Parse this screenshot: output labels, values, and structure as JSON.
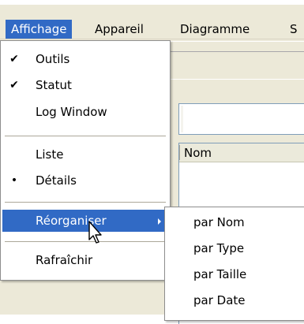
{
  "menubar": {
    "items": [
      {
        "label": "Affichage",
        "active": true
      },
      {
        "label": "Appareil",
        "active": false
      },
      {
        "label": "Diagramme",
        "active": false
      },
      {
        "label": "S",
        "active": false
      }
    ]
  },
  "background": {
    "list_header": "Nom"
  },
  "menu": {
    "items": [
      {
        "label": "Outils",
        "mark": "✔"
      },
      {
        "label": "Statut",
        "mark": "✔"
      },
      {
        "label": "Log Window",
        "mark": ""
      },
      {
        "label": "Liste",
        "mark": ""
      },
      {
        "label": "Détails",
        "mark": "•"
      },
      {
        "label": "Réorganiser",
        "mark": "",
        "has_submenu": true
      },
      {
        "label": "Rafraîchir",
        "mark": ""
      }
    ]
  },
  "submenu": {
    "items": [
      {
        "label": "par Nom"
      },
      {
        "label": "par Type"
      },
      {
        "label": "par Taille"
      },
      {
        "label": "par Date"
      }
    ]
  },
  "colors": {
    "highlight": "#316ac5",
    "menu_bg": "#ffffff",
    "chrome": "#ece9d8"
  },
  "icons": {
    "check": "check-icon",
    "bullet": "bullet-icon",
    "submenu_arrow": "chevron-right-icon",
    "cursor": "arrow-cursor-icon"
  }
}
